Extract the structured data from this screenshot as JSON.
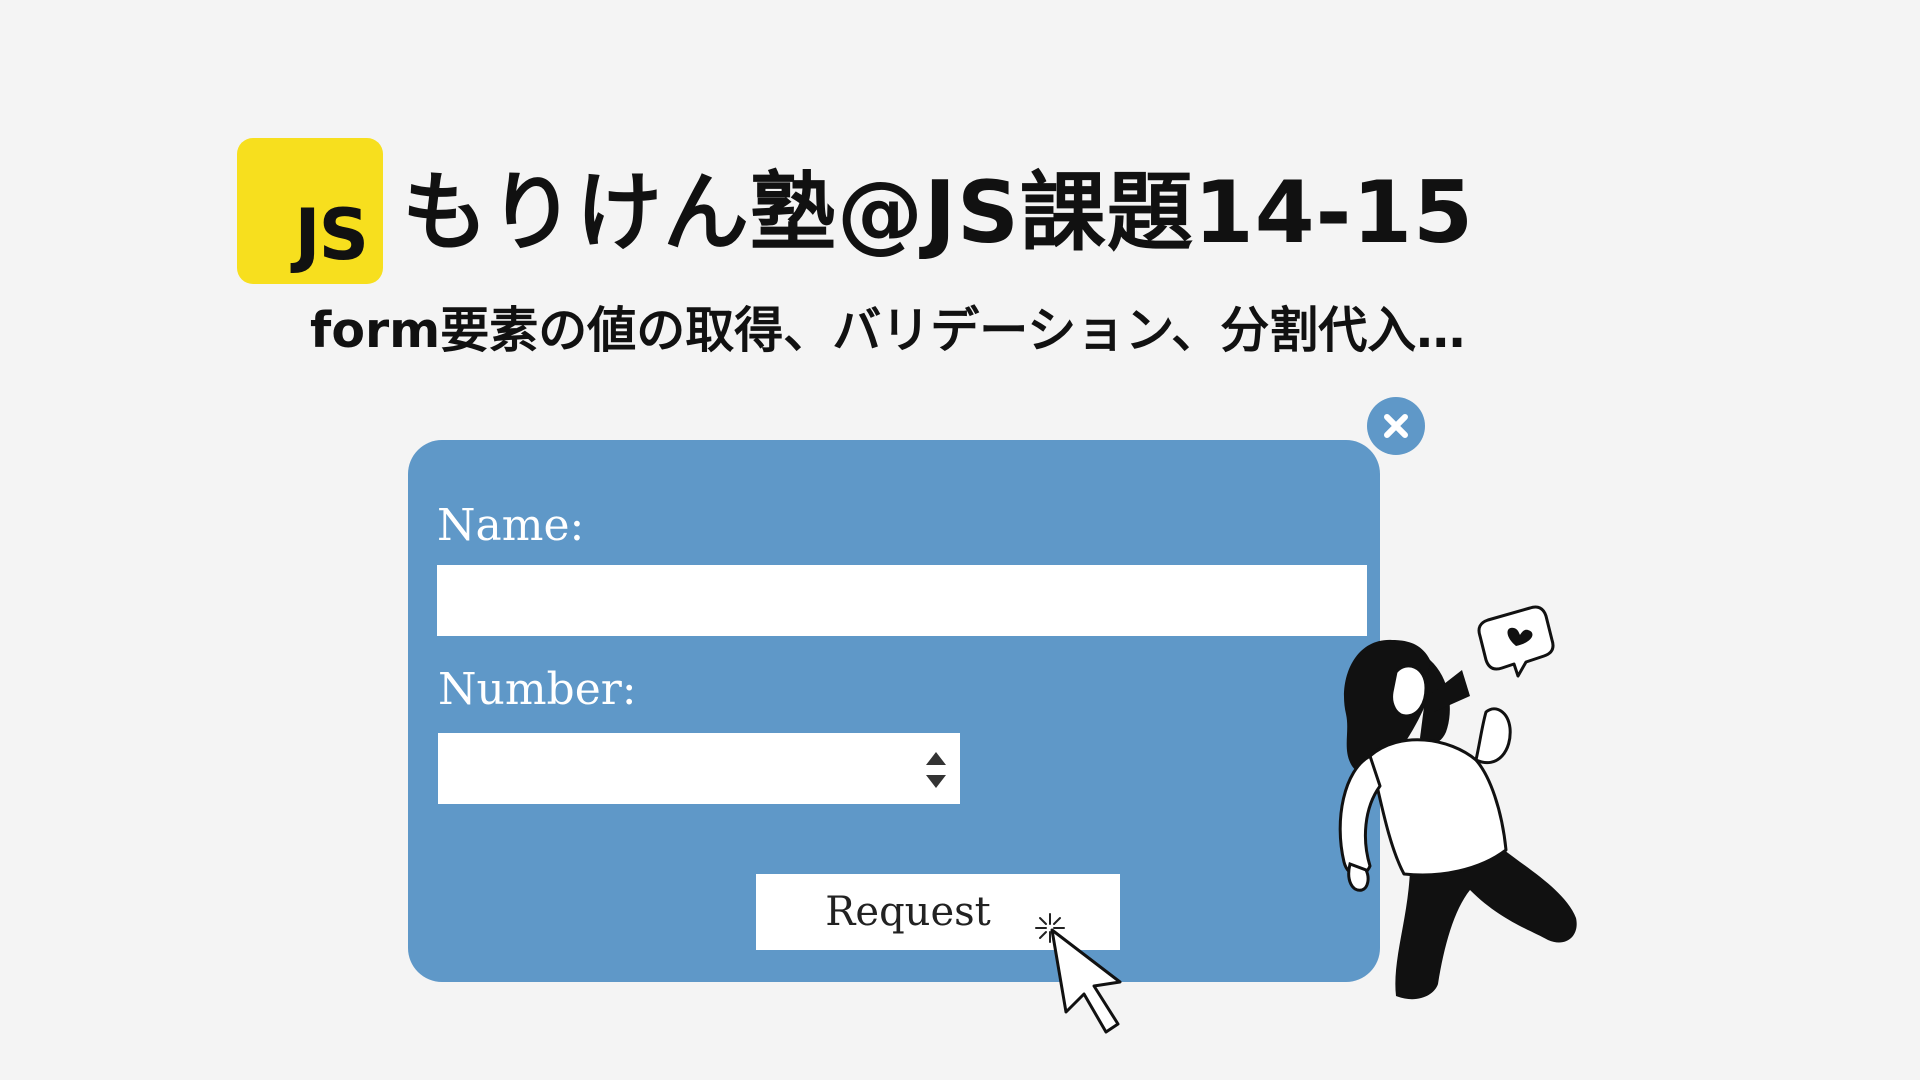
{
  "header": {
    "logo_text": "JS",
    "title": "もりけん塾@JS課題14-15",
    "subtitle": "form要素の値の取得、バリデーション、分割代入…"
  },
  "form": {
    "name_label": "Name:",
    "name_value": "",
    "number_label": "Number:",
    "number_value": "",
    "submit_label": "Request"
  },
  "icons": {
    "close": "close-icon",
    "spinner": "spinner-arrows-icon",
    "cursor": "mouse-pointer-icon",
    "illustration": "woman-with-megaphone-illustration",
    "speech_bubble": "heart-speech-bubble-icon"
  },
  "colors": {
    "background": "#f4f4f4",
    "js_yellow": "#f7df1e",
    "card_blue": "#5f98c8",
    "text_dark": "#111111",
    "white": "#ffffff"
  }
}
